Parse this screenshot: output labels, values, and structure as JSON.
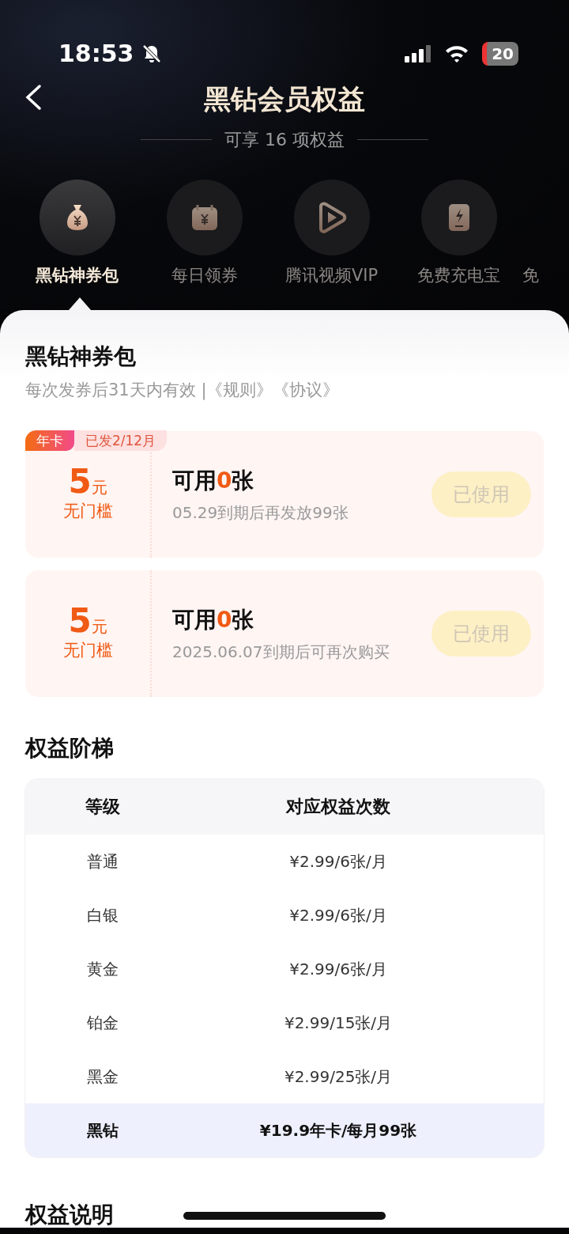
{
  "status_bar": {
    "time": "18:53",
    "battery": "20"
  },
  "header": {
    "title": "黑钻会员权益",
    "subtitle": "可享 16 项权益"
  },
  "tabs": [
    {
      "label": "黑钻神券包",
      "selected": true,
      "kind": "bag"
    },
    {
      "label": "每日领券",
      "selected": false,
      "kind": "calendar"
    },
    {
      "label": "腾讯视频VIP",
      "selected": false,
      "kind": "play"
    },
    {
      "label": "免费充电宝",
      "selected": false,
      "kind": "power"
    },
    {
      "label": "免",
      "selected": false,
      "kind": "partial"
    }
  ],
  "section": {
    "title": "黑钻神券包",
    "note": "每次发券后31天内有效 |",
    "links": [
      "《规则》",
      "《协议》"
    ]
  },
  "coupons": [
    {
      "tags": [
        "年卡",
        "已发2/12月"
      ],
      "amount": "5",
      "unit": "元",
      "condition": "无门槛",
      "title": "可用**0**张",
      "detail": "05.29到期后再发放99张",
      "button": "已使用",
      "disabled": true
    },
    {
      "amount": "5",
      "unit": "元",
      "condition": "无门槛",
      "title": "可用**0**张",
      "detail": "2025.06.07到期后可再次购买",
      "button": "已使用",
      "disabled": true
    }
  ],
  "ladder": {
    "title": "权益阶梯",
    "columns": [
      "等级",
      "对应权益次数"
    ],
    "rows": [
      {
        "cells": [
          "普通",
          "¥2.99/6张/月"
        ],
        "highlighted": false
      },
      {
        "cells": [
          "白银",
          "¥2.99/6张/月"
        ],
        "highlighted": false
      },
      {
        "cells": [
          "黄金",
          "¥2.99/6张/月"
        ],
        "highlighted": false
      },
      {
        "cells": [
          "铂金",
          "¥2.99/15张/月"
        ],
        "highlighted": false
      },
      {
        "cells": [
          "黑金",
          "¥2.99/25张/月"
        ],
        "highlighted": false
      },
      {
        "cells": [
          "黑钻",
          "¥19.9年卡/每月99张"
        ],
        "highlighted": true
      }
    ]
  },
  "next_section": {
    "title": "权益说明"
  }
}
